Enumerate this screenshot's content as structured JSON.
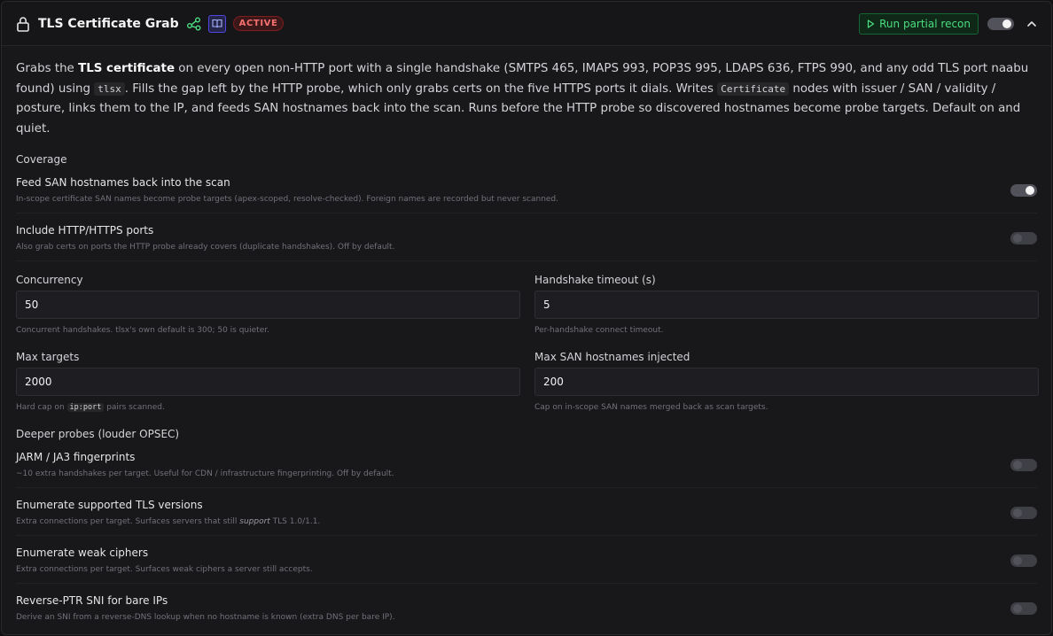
{
  "header": {
    "title": "TLS Certificate Grab",
    "badge": "ACTIVE",
    "run_label": "Run partial recon"
  },
  "description": {
    "p1": "Grabs the ",
    "b1": "TLS certificate",
    "p2": " on every open non-HTTP port with a single handshake (SMTPS 465, IMAPS 993, POP3S 995, LDAPS 636, FTPS 990, and any odd TLS port naabu found) using ",
    "code1": "tlsx",
    "p3": ". Fills the gap left by the HTTP probe, which only grabs certs on the five HTTPS ports it dials. Writes ",
    "code2": "Certificate",
    "p4": " nodes with issuer / SAN / validity / posture, links them to the IP, and feeds SAN hostnames back into the scan. Runs before the HTTP probe so discovered hostnames become probe targets. Default on and quiet."
  },
  "coverage": {
    "title": "Coverage",
    "items": [
      {
        "label": "Feed SAN hostnames back into the scan",
        "help": "In-scope certificate SAN names become probe targets (apex-scoped, resolve-checked). Foreign names are recorded but never scanned.",
        "enabled": true
      },
      {
        "label": "Include HTTP/HTTPS ports",
        "help": "Also grab certs on ports the HTTP probe already covers (duplicate handshakes). Off by default.",
        "enabled": false
      }
    ]
  },
  "fields": {
    "concurrency": {
      "label": "Concurrency",
      "value": "50",
      "help": "Concurrent handshakes. tlsx's own default is 300; 50 is quieter."
    },
    "timeout": {
      "label": "Handshake timeout (s)",
      "value": "5",
      "help": "Per-handshake connect timeout."
    },
    "max_targets": {
      "label": "Max targets",
      "value": "2000",
      "help_pre": "Hard cap on ",
      "help_code": "ip:port",
      "help_post": " pairs scanned."
    },
    "max_san": {
      "label": "Max SAN hostnames injected",
      "value": "200",
      "help": "Cap on in-scope SAN names merged back as scan targets."
    }
  },
  "deeper": {
    "title": "Deeper probes (louder OPSEC)",
    "jarm": {
      "label": "JARM / JA3 fingerprints",
      "help": "~10 extra handshakes per target. Useful for CDN / infrastructure fingerprinting. Off by default.",
      "enabled": false
    },
    "tls_versions": {
      "label": "Enumerate supported TLS versions",
      "help_pre": "Extra connections per target. Surfaces servers that still ",
      "help_em": "support",
      "help_post": " TLS 1.0/1.1.",
      "enabled": false
    },
    "weak_ciphers": {
      "label": "Enumerate weak ciphers",
      "help": "Extra connections per target. Surfaces weak ciphers a server still accepts.",
      "enabled": false
    },
    "reverse_ptr": {
      "label": "Reverse-PTR SNI for bare IPs",
      "help": "Derive an SNI from a reverse-DNS lookup when no hostname is known (extra DNS per bare IP).",
      "enabled": false
    }
  },
  "colors": {
    "accent_green": "#4ade80",
    "badge_red": "#f87171",
    "book_blue": "#6366f1"
  },
  "icons": {
    "lock": "lock-icon",
    "graph": "graph-icon",
    "book": "book-icon",
    "play": "play-icon",
    "chevron": "chevron-up-icon"
  }
}
